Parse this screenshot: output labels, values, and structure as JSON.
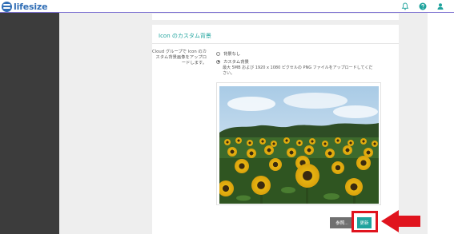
{
  "header": {
    "logo_text": "lifesize",
    "icons": [
      "bell-icon",
      "help-icon",
      "user-icon"
    ]
  },
  "section": {
    "title": "Icon のカスタム背景",
    "description": "Cloud グループで Icon のカスタム背景画像をアップロードします。",
    "options": [
      {
        "label": "背景なし",
        "selected": false
      },
      {
        "label": "カスタム背景",
        "selected": true
      }
    ],
    "hint": "最大 5MB および 1920 x 1080 ピクセルの PNG ファイルをアップロードしてください。"
  },
  "buttons": {
    "browse": "参照...",
    "update": "更新"
  },
  "colors": {
    "accent": "#1fa39d",
    "brand": "#2f6db5",
    "sidebar": "#3c3c3c",
    "callout": "#e0141e"
  }
}
